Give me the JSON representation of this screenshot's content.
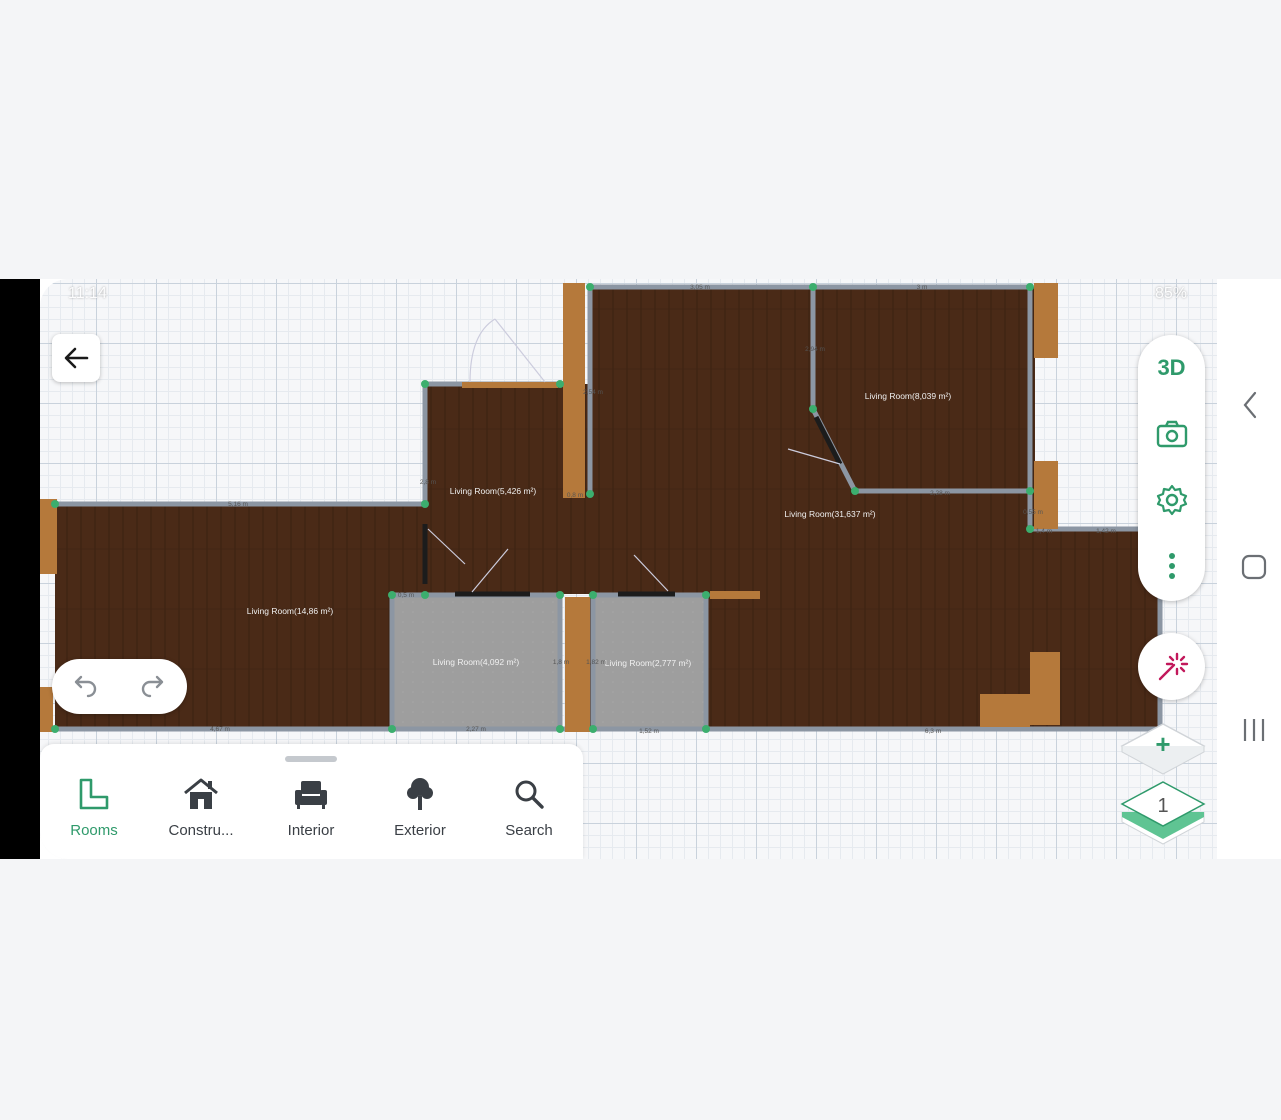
{
  "status_bar": {
    "time": "11:14",
    "battery": "85%"
  },
  "plan": {
    "rooms": [
      {
        "label": "Living Room(8,039 m²)"
      },
      {
        "label": "Living Room(5,426 m²)"
      },
      {
        "label": "Living Room(31,637 m²)"
      },
      {
        "label": "Living Room(14,86 m²)"
      },
      {
        "label": "Living Room(4,092 m²)"
      },
      {
        "label": "Living Room(2,777 m²)"
      }
    ],
    "dimensions": [
      "3,05 m",
      "3 m",
      "5,16 m",
      "2,54 m",
      "2,8 m",
      "2,94 m",
      "0,8 m",
      "2,28 m",
      "1,4 m",
      "1,42 m",
      "0,55 m",
      "4,67 m",
      "2,27 m",
      "1,52 m",
      "6,3 m",
      "1,8 m",
      "1,82 m",
      "0,5 m"
    ]
  },
  "toolbar_right": {
    "view_3d_label": "3D",
    "camera_icon": "camera-icon",
    "settings_icon": "gear-icon",
    "more_icon": "more-vertical-icon",
    "magic_icon": "magic-wand-icon"
  },
  "history": {
    "undo_icon": "undo-icon",
    "redo_icon": "redo-icon"
  },
  "bottom_tabs": [
    {
      "label": "Rooms",
      "icon": "room-shape-icon",
      "active": true
    },
    {
      "label": "Constru...",
      "icon": "house-icon",
      "active": false
    },
    {
      "label": "Interior",
      "icon": "armchair-icon",
      "active": false
    },
    {
      "label": "Exterior",
      "icon": "tree-icon",
      "active": false
    },
    {
      "label": "Search",
      "icon": "search-icon",
      "active": false
    }
  ],
  "floors": {
    "add_label": "+",
    "current_floor": "1"
  },
  "colors": {
    "accent": "#2f9a6b",
    "floor_wood": "#4a2a17",
    "wall": "#8c96a3",
    "tile": "#9e9e9e",
    "magic": "#c2185b"
  }
}
